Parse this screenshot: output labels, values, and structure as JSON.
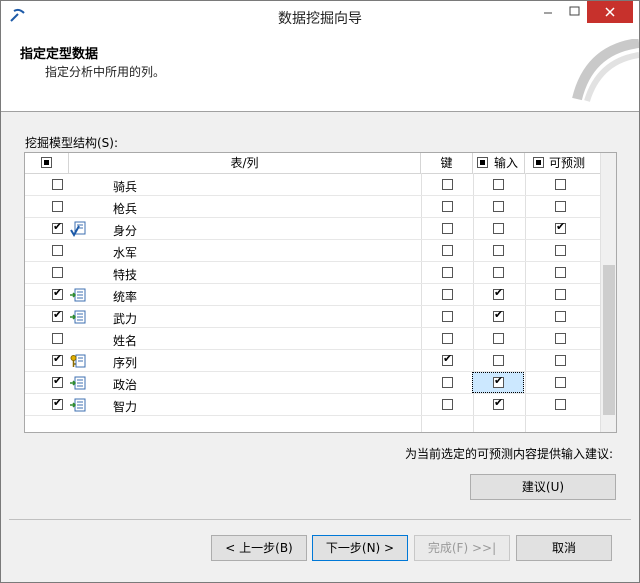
{
  "window": {
    "title": "数据挖掘向导"
  },
  "header": {
    "title": "指定定型数据",
    "subtitle": "指定分析中所用的列。"
  },
  "structure_label": "挖掘模型结构(S):",
  "grid": {
    "columns": {
      "table_col": "表/列",
      "key": "键",
      "input": "输入",
      "predict": "可预测"
    },
    "rows": [
      {
        "name": "骑兵",
        "use": false,
        "icon": "",
        "key": false,
        "input": false,
        "predict": false
      },
      {
        "name": "枪兵",
        "use": false,
        "icon": "",
        "key": false,
        "input": false,
        "predict": false
      },
      {
        "name": "身分",
        "use": true,
        "icon": "predict-column-icon",
        "key": false,
        "input": false,
        "predict": true
      },
      {
        "name": "水军",
        "use": false,
        "icon": "",
        "key": false,
        "input": false,
        "predict": false
      },
      {
        "name": "特技",
        "use": false,
        "icon": "",
        "key": false,
        "input": false,
        "predict": false
      },
      {
        "name": "统率",
        "use": true,
        "icon": "input-column-icon",
        "key": false,
        "input": true,
        "predict": false
      },
      {
        "name": "武力",
        "use": true,
        "icon": "input-column-icon",
        "key": false,
        "input": true,
        "predict": false
      },
      {
        "name": "姓名",
        "use": false,
        "icon": "",
        "key": false,
        "input": false,
        "predict": false
      },
      {
        "name": "序列",
        "use": true,
        "icon": "key-column-icon",
        "key": true,
        "input": false,
        "predict": false
      },
      {
        "name": "政治",
        "use": true,
        "icon": "input-column-icon",
        "key": false,
        "input": true,
        "predict": false
      },
      {
        "name": "智力",
        "use": true,
        "icon": "input-column-icon",
        "key": false,
        "input": true,
        "predict": false
      }
    ]
  },
  "hint": "为当前选定的可预测内容提供输入建议:",
  "buttons": {
    "suggest": "建议(U)",
    "back": "< 上一步(B)",
    "next": "下一步(N) >",
    "finish": "完成(F) >>|",
    "cancel": "取消"
  }
}
